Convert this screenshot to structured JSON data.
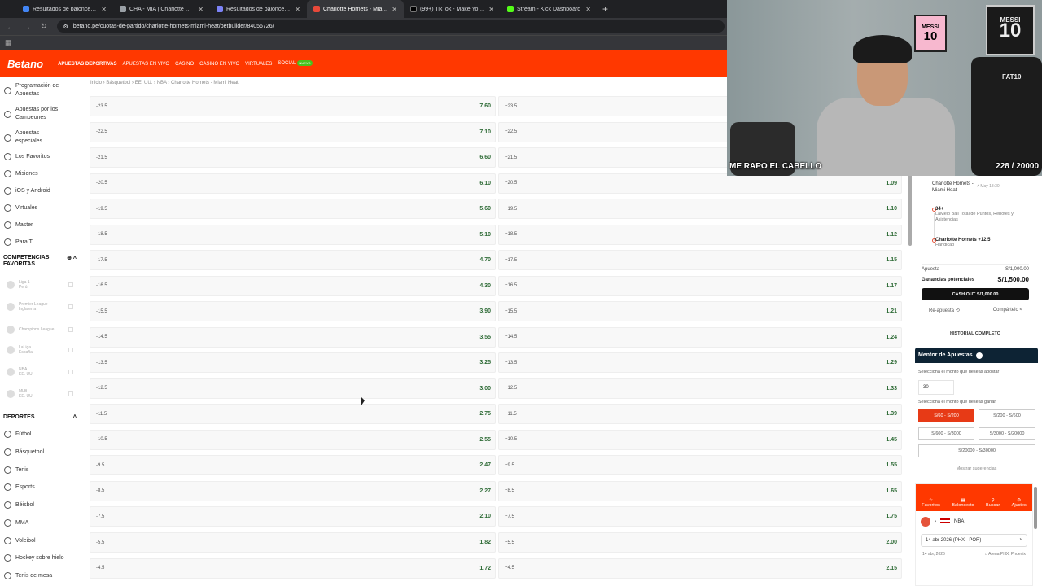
{
  "browser": {
    "tabs": [
      {
        "title": "Resultados de baloncesto en v",
        "color": "#4285f4"
      },
      {
        "title": "CHA - MIA | Charlotte Hornets",
        "color": "#9aa0a6"
      },
      {
        "title": "Resultados de baloncesto en d",
        "color": "#7c83f7"
      },
      {
        "title": "Charlotte Hornets - Miami Heat",
        "color": "#e8493a",
        "active": true
      },
      {
        "title": "(99+) TikTok - Make Your Day",
        "color": "#000000"
      },
      {
        "title": "Stream - Kick Dashboard",
        "color": "#53fc18"
      }
    ],
    "url": "betano.pe/cuotas-de-partido/charlotte-hornets-miami-heat/betbuilder/84056726/"
  },
  "header": {
    "logo": "Betano",
    "nav": [
      "APUESTAS DEPORTIVAS",
      "APUESTAS EN VIVO",
      "CASINO",
      "CASINO EN VIVO",
      "VIRTUALES",
      "SOCIAL"
    ],
    "new_badge": "NUEVO"
  },
  "sidebar": {
    "items": [
      "Programación de Apuestas",
      "Apuestas por los Campeones",
      "Apuestas especiales",
      "Los Favoritos",
      "Misiones",
      "iOS y Android",
      "Virtuales",
      "Master",
      "Para Ti"
    ],
    "favorites_title": "COMPETENCIAS FAVORITAS",
    "favorites": [
      {
        "name": "Liga 1",
        "country": "Perú"
      },
      {
        "name": "Premier League",
        "country": "Inglaterra"
      },
      {
        "name": "Champions League",
        "country": ""
      },
      {
        "name": "LaLiga",
        "country": "España"
      },
      {
        "name": "NBA",
        "country": "EE. UU."
      },
      {
        "name": "MLB",
        "country": "EE. UU."
      }
    ],
    "sports_title": "DEPORTES",
    "sports": [
      "Fútbol",
      "Básquetbol",
      "Tenis",
      "Esports",
      "Béisbol",
      "MMA",
      "Voleibol",
      "Hockey sobre hielo",
      "Tenis de mesa"
    ]
  },
  "breadcrumb": "Inicio  ›  Básquetbol  ›  EE. UU.  ›  NBA  ›  Charlotte Hornets - Miami Heat",
  "odds": [
    {
      "l": "-23.5",
      "lo": "7.60",
      "r": "+23.5",
      "ro": ""
    },
    {
      "l": "-22.5",
      "lo": "7.10",
      "r": "+22.5",
      "ro": ""
    },
    {
      "l": "-21.5",
      "lo": "6.60",
      "r": "+21.5",
      "ro": ""
    },
    {
      "l": "-20.5",
      "lo": "6.10",
      "r": "+20.5",
      "ro": "1.09"
    },
    {
      "l": "-19.5",
      "lo": "5.60",
      "r": "+19.5",
      "ro": "1.10"
    },
    {
      "l": "-18.5",
      "lo": "5.10",
      "r": "+18.5",
      "ro": "1.12"
    },
    {
      "l": "-17.5",
      "lo": "4.70",
      "r": "+17.5",
      "ro": "1.15"
    },
    {
      "l": "-16.5",
      "lo": "4.30",
      "r": "+16.5",
      "ro": "1.17"
    },
    {
      "l": "-15.5",
      "lo": "3.90",
      "r": "+15.5",
      "ro": "1.21"
    },
    {
      "l": "-14.5",
      "lo": "3.55",
      "r": "+14.5",
      "ro": "1.24"
    },
    {
      "l": "-13.5",
      "lo": "3.25",
      "r": "+13.5",
      "ro": "1.29"
    },
    {
      "l": "-12.5",
      "lo": "3.00",
      "r": "+12.5",
      "ro": "1.33"
    },
    {
      "l": "-11.5",
      "lo": "2.75",
      "r": "+11.5",
      "ro": "1.39"
    },
    {
      "l": "-10.5",
      "lo": "2.55",
      "r": "+10.5",
      "ro": "1.45"
    },
    {
      "l": "-9.5",
      "lo": "2.47",
      "r": "+9.5",
      "ro": "1.55"
    },
    {
      "l": "-8.5",
      "lo": "2.27",
      "r": "+8.5",
      "ro": "1.65"
    },
    {
      "l": "-7.5",
      "lo": "2.10",
      "r": "+7.5",
      "ro": "1.75"
    },
    {
      "l": "-5.5",
      "lo": "1.82",
      "r": "+5.5",
      "ro": "2.00"
    },
    {
      "l": "-4.5",
      "lo": "1.72",
      "r": "+4.5",
      "ro": "2.15"
    }
  ],
  "webcam": {
    "caption": "ME RAPO EL CABELLO",
    "goal": "228 / 20000",
    "jersey1_name": "MESSI",
    "jersey1_num": "10",
    "jersey2_name": "MESSI",
    "jersey2_num": "10",
    "chair_label": "FAT10"
  },
  "betslip": {
    "match": "Charlotte Hornets - Miami Heat",
    "date": "May 18:30",
    "sel1_title": "34+",
    "sel1_sub": "LaMelo Ball Total de Puntos, Rebotes y Asistencias",
    "sel2_title": "Charlotte Hornets +12.5",
    "sel2_sub": "Hándicap",
    "stake_label": "Apuesta",
    "stake_value": "S/1,000.00",
    "potential_label": "Ganancias potenciales",
    "potential_value": "S/1,500.00",
    "cashout": "CASH OUT  S/1,000.00",
    "reapuesta": "Re-apuesta",
    "compartelo": "Compártelo",
    "history": "HISTORIAL COMPLETO"
  },
  "mentor": {
    "title": "Mentor de Apuestas",
    "amount_label": "Selecciona el monto que deseas apostar",
    "amount_value": "30",
    "win_label": "Selecciona el monto que deseas ganar",
    "ranges": [
      "S/60 - S/200",
      "S/200 - S/600",
      "S/600 - S/3000",
      "S/3000 - S/20000",
      "S/20000 - S/30000"
    ],
    "more": "Mostrar sugerencias"
  },
  "mobile": {
    "nav": [
      "Favoritos",
      "Baloncesto",
      "Buscar",
      "Ajustes"
    ],
    "league": "NBA",
    "match_select": "14 abr 2026 (PHX - POR)",
    "date": "14 abr, 2026",
    "venue": "Arena PHX, Phoenix"
  }
}
